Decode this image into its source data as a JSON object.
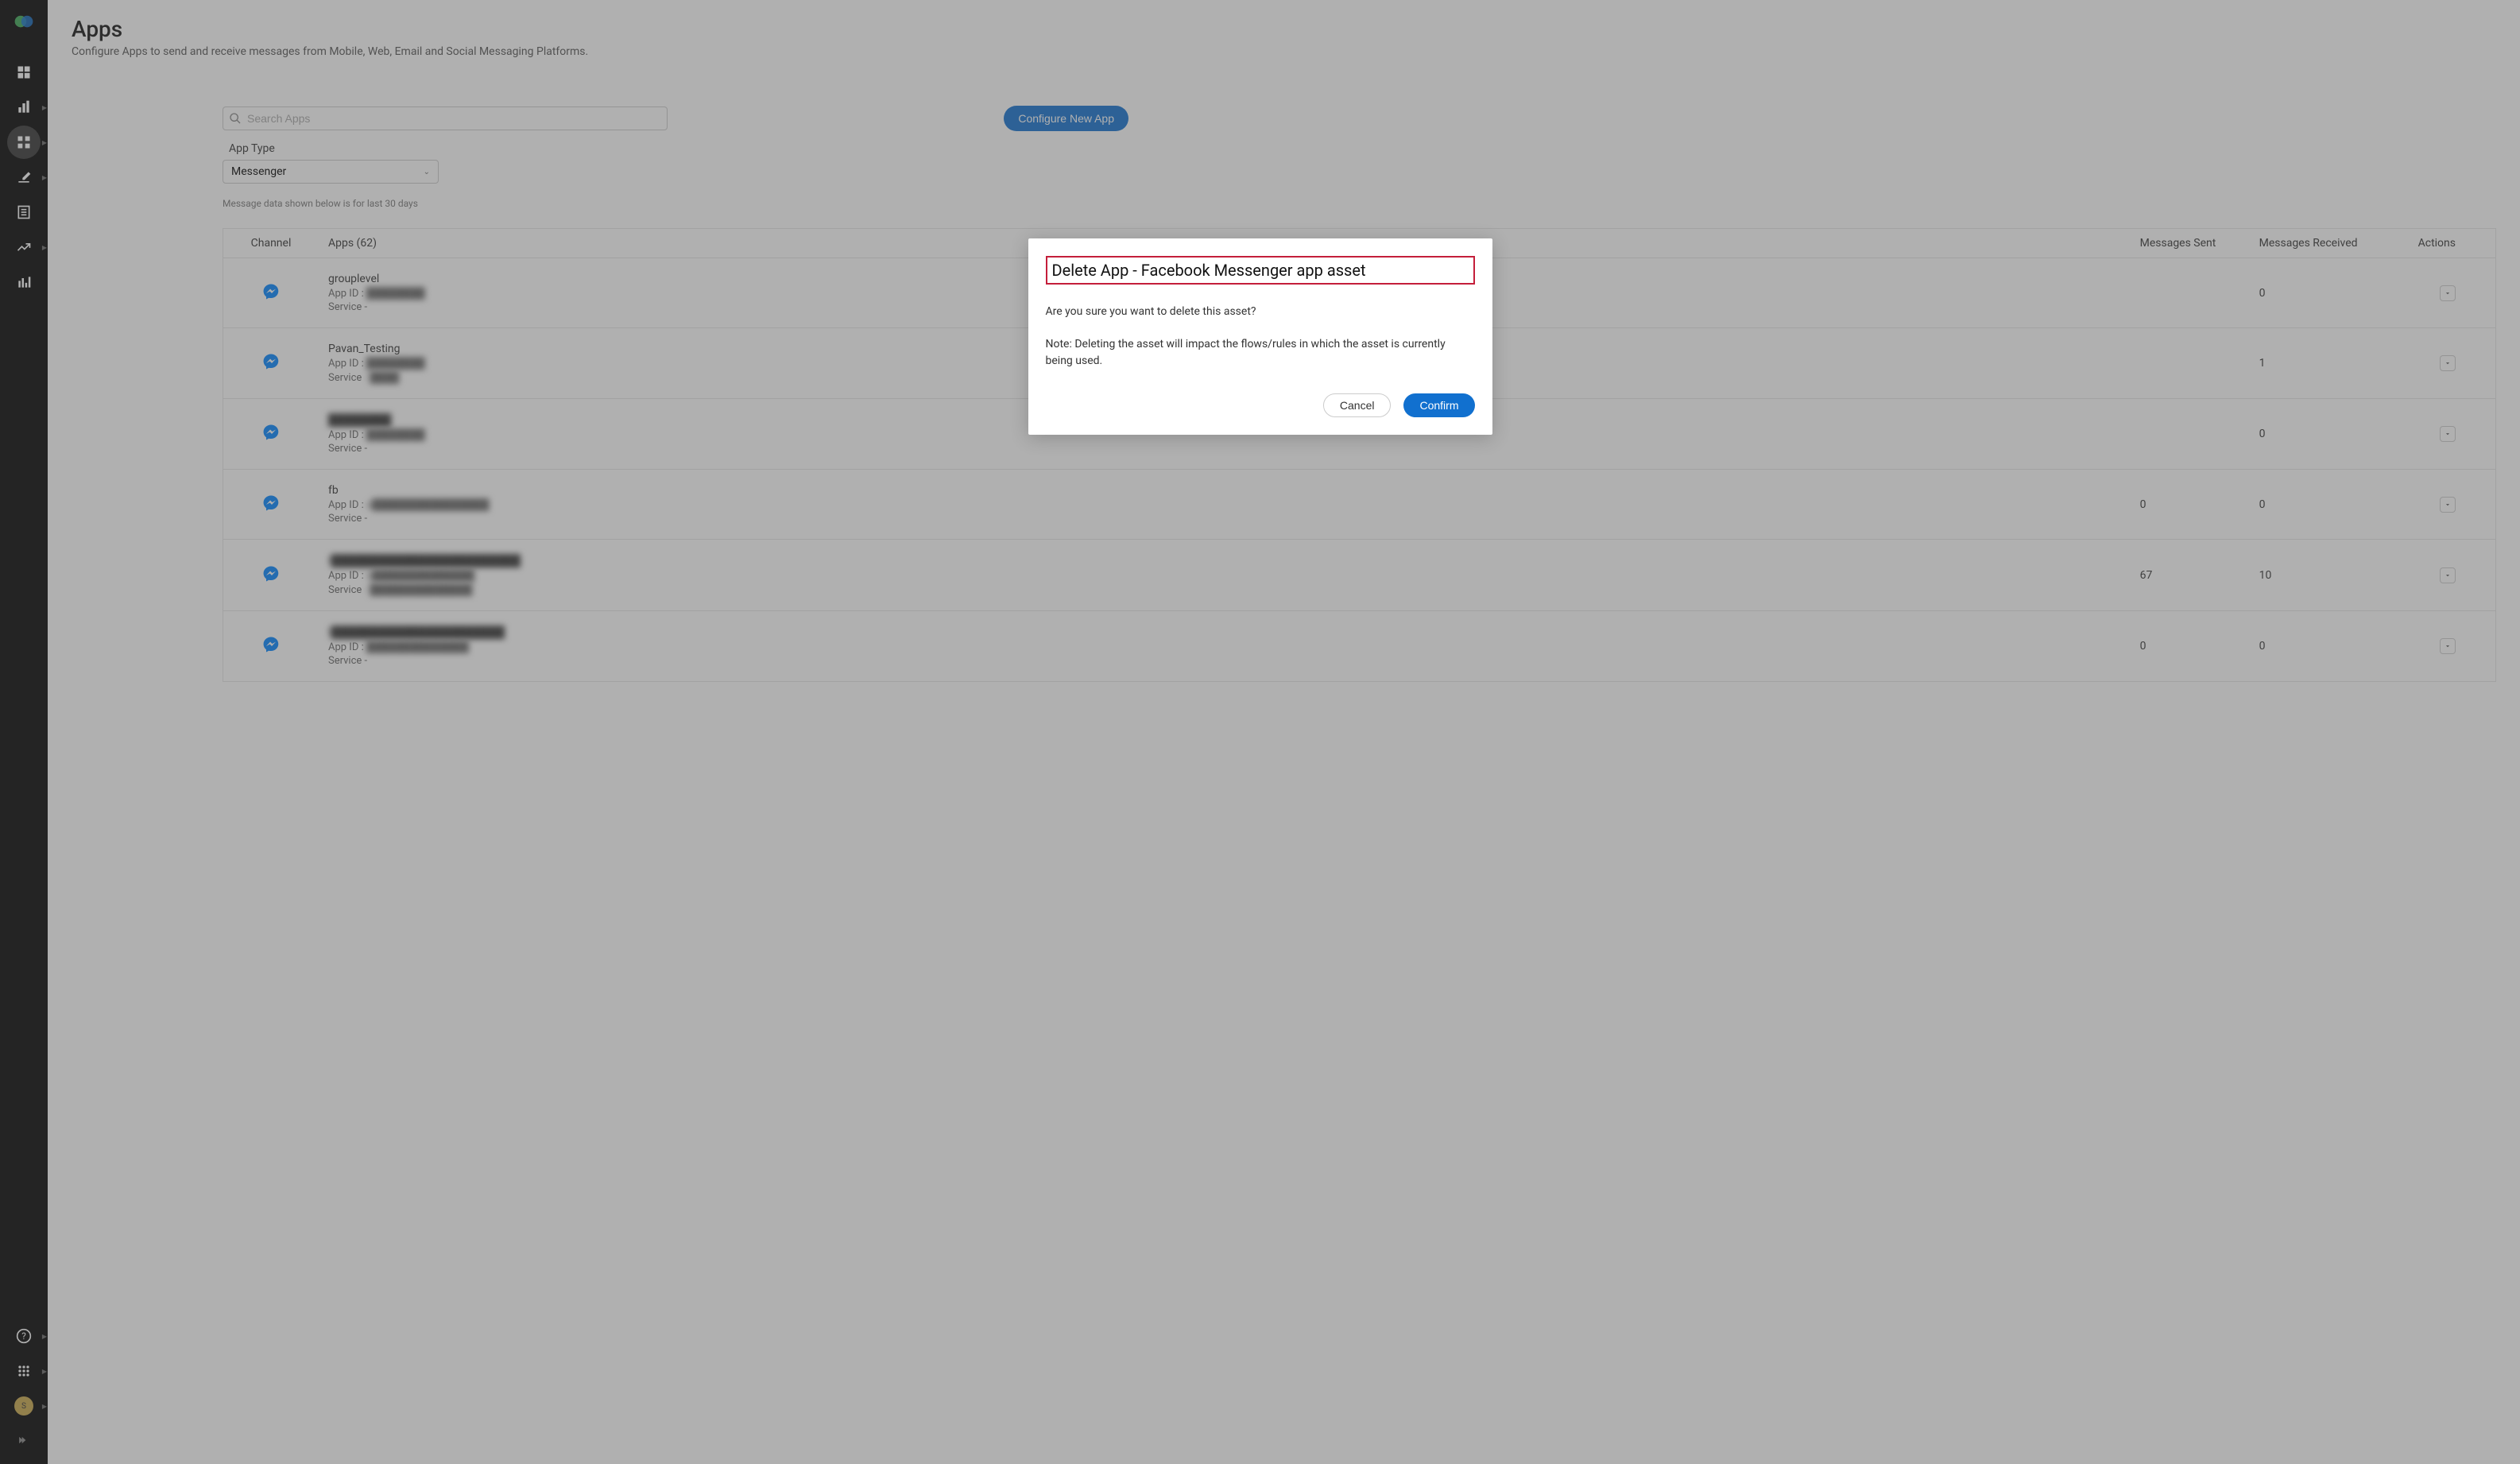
{
  "page": {
    "title": "Apps",
    "subtitle": "Configure Apps to send and receive messages from Mobile, Web, Email and Social Messaging Platforms."
  },
  "search": {
    "placeholder": "Search Apps"
  },
  "configure_button": "Configure New App",
  "app_type": {
    "label": "App Type",
    "selected": "Messenger"
  },
  "note": "Message data shown below is for last 30 days",
  "columns": {
    "channel": "Channel",
    "apps": "Apps (62)",
    "sent": "Messages Sent",
    "received": "Messages Received",
    "actions": "Actions"
  },
  "rows": [
    {
      "name": "grouplevel",
      "name_blur": false,
      "app_id_label": "App ID :",
      "app_id": "████████",
      "service_label": "Service",
      "service": "-",
      "sent": "",
      "received": "0"
    },
    {
      "name": "Pavan_Testing",
      "name_blur": false,
      "app_id_label": "App ID :",
      "app_id": "████████",
      "service_label": "Service",
      "service": "- ████",
      "sent": "",
      "received": "1"
    },
    {
      "name": "████████",
      "name_blur": true,
      "app_id_label": "App ID :",
      "app_id": "████████",
      "service_label": "Service",
      "service": "-",
      "sent": "",
      "received": "0"
    },
    {
      "name": "fb",
      "name_blur": false,
      "app_id_label": "App ID :",
      "app_id": "a████████████████",
      "service_label": "Service",
      "service": "-",
      "sent": "0",
      "received": "0"
    },
    {
      "name": "I████████████████████████",
      "name_blur": true,
      "app_id_label": "App ID :",
      "app_id": "a██████████████",
      "service_label": "Service",
      "service": "- ██████████████",
      "sent": "67",
      "received": "10"
    },
    {
      "name": "I██████████████████████",
      "name_blur": true,
      "app_id_label": "App ID :",
      "app_id": "██████████████",
      "service_label": "Service",
      "service": "-",
      "sent": "0",
      "received": "0"
    }
  ],
  "modal": {
    "title": "Delete App - Facebook Messenger app asset",
    "line1": "Are you sure you want to delete this asset?",
    "line2": "Note: Deleting the asset will impact the flows/rules in which the asset is currently being used.",
    "cancel": "Cancel",
    "confirm": "Confirm"
  }
}
